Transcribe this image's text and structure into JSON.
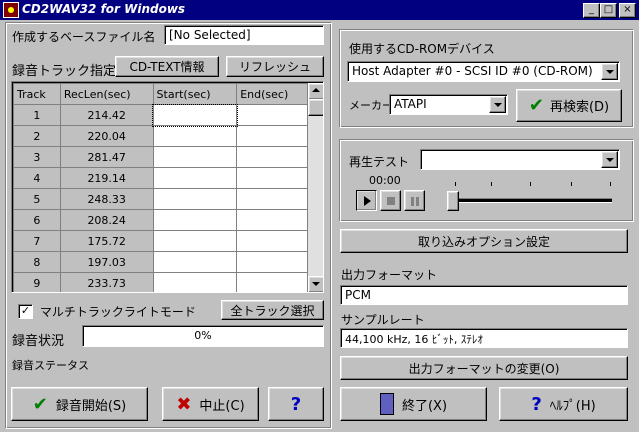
{
  "window": {
    "title": "CD2WAV32 for Windows"
  },
  "left": {
    "base_file_label": "作成するベースファイル名",
    "base_file_value": "[No Selected]",
    "tracks_label": "録音トラック指定",
    "cdtext_button": "CD-TEXT情報",
    "refresh_button": "リフレッシュ",
    "columns": [
      "Track",
      "RecLen(sec)",
      "Start(sec)",
      "End(sec)"
    ],
    "rows": [
      {
        "track": "1",
        "reclen": "214.42"
      },
      {
        "track": "2",
        "reclen": "220.04"
      },
      {
        "track": "3",
        "reclen": "281.47"
      },
      {
        "track": "4",
        "reclen": "219.14"
      },
      {
        "track": "5",
        "reclen": "248.33"
      },
      {
        "track": "6",
        "reclen": "208.24"
      },
      {
        "track": "7",
        "reclen": "175.72"
      },
      {
        "track": "8",
        "reclen": "197.03"
      },
      {
        "track": "9",
        "reclen": "233.73"
      }
    ],
    "multitrack_label": "マルチトラックライトモード",
    "multitrack_checked": true,
    "select_all_button": "全トラック選択",
    "rec_status_label": "録音状況",
    "progress_text": "0%",
    "progress_value": 0,
    "rec_status_text_label": "録音ステータス",
    "start_button": "録音開始(S)",
    "stop_button": "中止(C)",
    "help_button": "?"
  },
  "right": {
    "device_label": "使用するCD-ROMデバイス",
    "device_value": "Host Adapter #0 - SCSI ID #0  (CD-ROM)",
    "maker_label": "メーカー",
    "maker_value": "ATAPI",
    "rescan_button": "再検索(D)",
    "playtest_label": "再生テスト",
    "playtest_value": "",
    "time_display": "00:00",
    "rip_options_button": "取り込みオプション設定",
    "output_format_label": "出力フォーマット",
    "output_format_value": "PCM",
    "sample_rate_label": "サンプルレート",
    "sample_rate_value": "44,100 kHz, 16 ﾋﾞｯﾄ, ｽﾃﾚｵ",
    "change_format_button": "出力フォーマットの変更(O)",
    "exit_button": "終了(X)",
    "help_button": "ﾍﾙﾌﾟ(H)"
  },
  "colors": {
    "titlebar": "#000080",
    "face": "#c0c0c0",
    "check_green": "#008000",
    "stop_red": "#c00000",
    "help_blue": "#0000c0"
  }
}
